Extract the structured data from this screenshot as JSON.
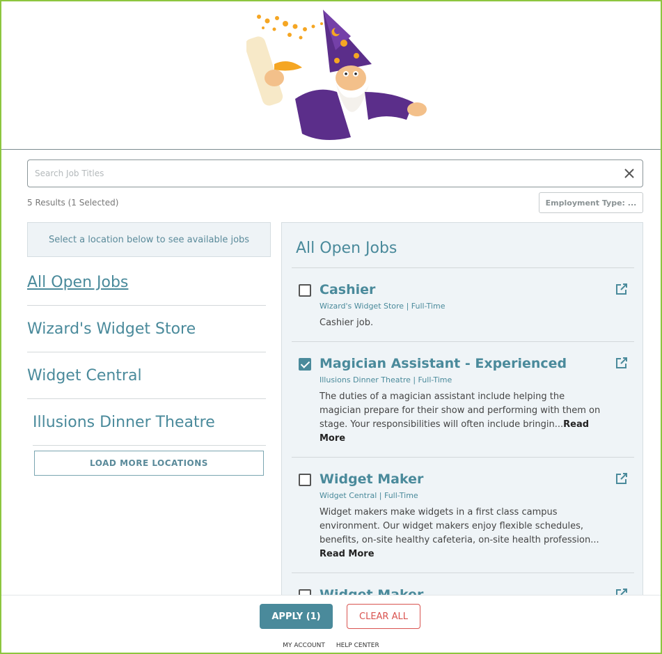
{
  "search": {
    "placeholder": "Search Job Titles",
    "value": ""
  },
  "results_text": "5 Results (1 Selected)",
  "employment_filter_label": "Employment Type: ...",
  "location_hint": "Select a location below to see available jobs",
  "locations": [
    {
      "label": "All Open Jobs",
      "active": true
    },
    {
      "label": "Wizard's Widget Store",
      "active": false
    },
    {
      "label": "Widget Central",
      "active": false
    },
    {
      "label": "Illusions Dinner Theatre",
      "active": false
    }
  ],
  "load_more_label": "LOAD MORE LOCATIONS",
  "jobs_title": "All Open Jobs",
  "jobs": [
    {
      "title": "Cashier",
      "meta": "Wizard's Widget Store | Full-Time",
      "description": "Cashier job.",
      "read_more": "",
      "checked": false
    },
    {
      "title": "Magician Assistant - Experienced",
      "meta": "Illusions Dinner Theatre | Full-Time",
      "description": "The duties of a magician assistant include helping the magician prepare for their show and performing with them on stage. Your responsibilities will often include bringin...",
      "read_more": "Read More",
      "checked": true
    },
    {
      "title": "Widget Maker",
      "meta": "Widget Central | Full-Time",
      "description": "Widget makers make widgets in a first class campus environment. Our widget makers enjoy flexible schedules, benefits, on-site healthy cafeteria, on-site health profession...",
      "read_more": "Read More",
      "checked": false
    },
    {
      "title": "Widget Maker",
      "meta": "",
      "description": "",
      "read_more": "",
      "checked": false
    }
  ],
  "apply_label": "APPLY (1)",
  "clear_label": "CLEAR ALL",
  "footer_links": {
    "account": "MY ACCOUNT",
    "help": "HELP CENTER"
  },
  "colors": {
    "accent": "#4a8a9b",
    "frame": "#8dc63f",
    "danger": "#d9534f",
    "panel_bg": "#eff4f7"
  },
  "icons": {
    "logo": "wizard-logo",
    "clear": "close-icon",
    "external": "external-link-icon",
    "checkbox": "checkbox-icon"
  }
}
